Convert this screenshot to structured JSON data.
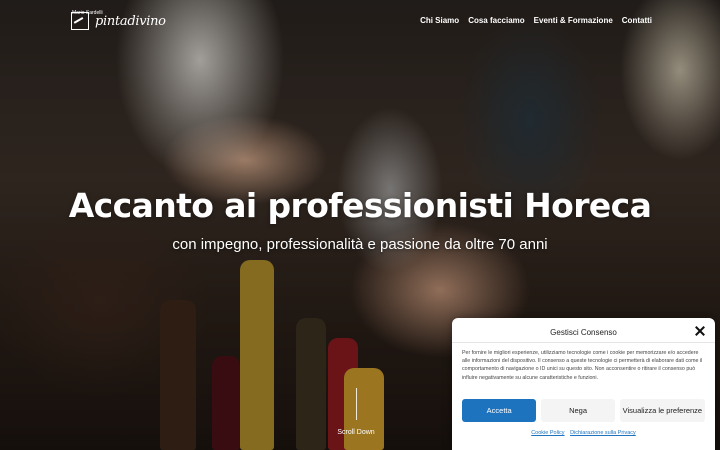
{
  "header": {
    "logo_small": "Mario Sardelli",
    "logo_text": "pintadivino",
    "nav": [
      {
        "label": "Chi Siamo"
      },
      {
        "label": "Cosa facciamo"
      },
      {
        "label": "Eventi & Formazione"
      },
      {
        "label": "Contatti"
      }
    ]
  },
  "hero": {
    "title": "Accanto ai professionisti Horeca",
    "subtitle": "con impegno, professionalità e passione da oltre 70 anni",
    "scroll_label": "Scroll Down"
  },
  "consent": {
    "title": "Gestisci Consenso",
    "text": "Per fornire le migliori esperienze, utilizziamo tecnologie come i cookie per memorizzare e/o accedere alle informazioni del dispositivo. Il consenso a queste tecnologie ci permetterà di elaborare dati come il comportamento di navigazione o ID unici su questo sito. Non acconsentire o ritirare il consenso può influire negativamente su alcune caratteristiche e funzioni.",
    "accept_label": "Accetta",
    "deny_label": "Nega",
    "prefs_label": "Visualizza le preferenze",
    "cookie_policy_label": "Cookie Policy",
    "privacy_label": "Dichiarazione sulla Privacy"
  },
  "colors": {
    "accent": "#1e73be"
  }
}
